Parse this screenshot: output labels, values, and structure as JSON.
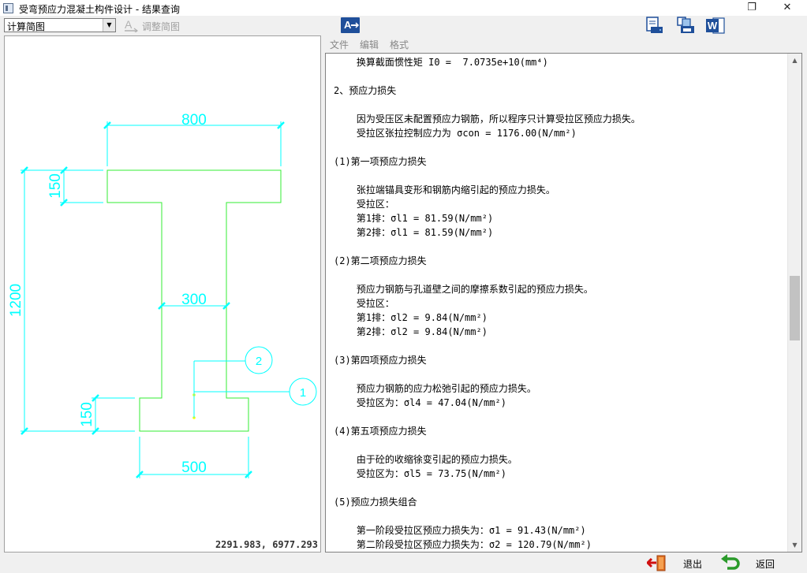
{
  "window": {
    "title": "受弯预应力混凝土构件设计 - 结果查询",
    "maximize_glyph": "❐",
    "close_glyph": "✕"
  },
  "left_toolbar": {
    "view_select": "计算简图",
    "adjust_label": "调整简图",
    "adjust_icon_letter": "A"
  },
  "drawing": {
    "dims": {
      "top_width": "800",
      "top_flange_height": "150",
      "total_height": "1200",
      "web_width": "300",
      "bottom_flange_height": "150",
      "bottom_width": "500"
    },
    "markers": [
      "1",
      "2"
    ],
    "colors": {
      "section": "#33ee33",
      "dimension": "#00ffff",
      "rebar": "#ffff00"
    },
    "coordinate_readout": "2291.983, 6977.293"
  },
  "right_toolbar": {
    "icons": [
      "font-settings-icon",
      "print-preview-icon",
      "print-icon",
      "word-export-icon"
    ],
    "word_letter": "W"
  },
  "menu": [
    "文件",
    "编辑",
    "格式"
  ],
  "results": [
    "    换算截面惯性矩 I0 =  7.0735e+10(mm⁴)",
    "",
    "2、预应力损失",
    "",
    "    因为受压区未配置预应力钢筋，所以程序只计算受拉区预应力损失。",
    "    受拉区张拉控制应力为 σcon = 1176.00(N/mm²)",
    "",
    "(1)第一项预应力损失",
    "",
    "    张拉端锚具变形和钢筋内缩引起的预应力损失。",
    "    受拉区：",
    "    第1排：σl1 = 81.59(N/mm²)",
    "    第2排：σl1 = 81.59(N/mm²)",
    "",
    "(2)第二项预应力损失",
    "",
    "    预应力钢筋与孔道壁之间的摩擦系数引起的预应力损失。",
    "    受拉区：",
    "    第1排：σl2 = 9.84(N/mm²)",
    "    第2排：σl2 = 9.84(N/mm²)",
    "",
    "(3)第四项预应力损失",
    "",
    "    预应力钢筋的应力松弛引起的预应力损失。",
    "    受拉区为：σl4 = 47.04(N/mm²)",
    "",
    "(4)第五项预应力损失",
    "",
    "    由于砼的收缩徐变引起的预应力损失。",
    "    受拉区为：σl5 = 73.75(N/mm²)",
    "",
    "(5)预应力损失组合",
    "",
    "    第一阶段受拉区预应力损失为：σ1 = 91.43(N/mm²)",
    "    第二阶段受拉区预应力损失为：σ2 = 120.79(N/mm²)"
  ],
  "scrollbar": {
    "position": 0.45
  },
  "bottom_bar": {
    "exit_label": "退出",
    "back_label": "返回"
  }
}
